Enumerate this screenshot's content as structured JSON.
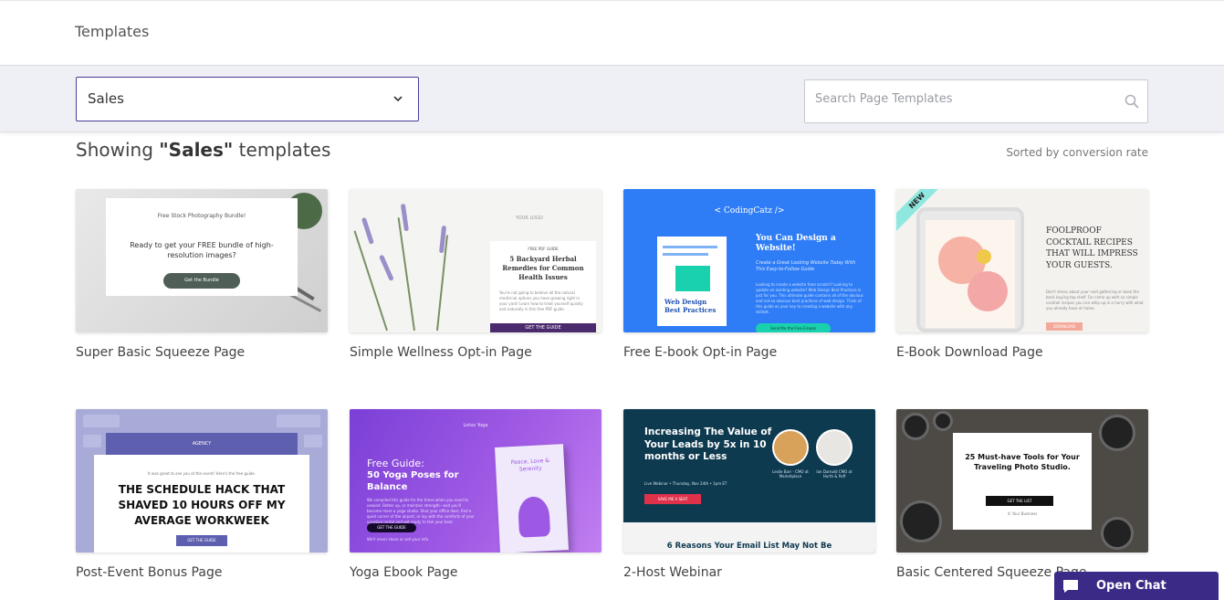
{
  "header": {
    "title": "Templates"
  },
  "filter": {
    "category_value": "Sales",
    "search_placeholder": "Search Page Templates"
  },
  "results": {
    "showing_prefix": "Showing ",
    "category": "\"Sales\"",
    "showing_suffix": " templates",
    "sorted_label": "Sorted by conversion rate"
  },
  "templates": [
    {
      "label": "Super Basic Squeeze Page",
      "thumb": {
        "line1": "Free Stock Photography Bundle!",
        "headline": "Ready to get your FREE bundle of high-resolution images?",
        "button": "Get the Bundle"
      }
    },
    {
      "label": "Simple Wellness Opt-in Page",
      "thumb": {
        "logo": "YOUR LOGO",
        "kicker": "FREE PDF GUIDE",
        "headline": "5 Backyard Herbal Remedies for Common Health Issues",
        "body": "You're not going to believe all the natural medicinal options you have growing right in your yard! Learn how to treat yourself quickly and naturally in this free PDF guide.",
        "button": "GET THE GUIDE"
      }
    },
    {
      "label": "Free E-book Opt-in Page",
      "thumb": {
        "brand": "< CodingCatz />",
        "book_title": "Web Design Best Practices",
        "headline": "You Can Design a Website!",
        "subhead": "Create a Great Looking Website Today With This Easy-to-Follow Guide",
        "body": "Looking to create a website from scratch? Looking to update an existing website? Web Design Best Practices is just for you. This ultimate guide contains all of the obvious and not-so-obvious best practices of web design. Think of this guide as your key to creating a website with any skillset.",
        "button": "Send Me the Free E-book"
      }
    },
    {
      "label": "E-Book Download Page",
      "thumb": {
        "badge": "NEW",
        "headline": "FOOLPROOF COCKTAIL RECIPES THAT WILL IMPRESS YOUR GUESTS.",
        "body": "Don't stress about your next gathering or book the bank buying top-shelf. For come up with so simple cocktail recipes you can whip up in a hurry with what you already have at home.",
        "button": "DOWNLOAD"
      }
    },
    {
      "label": "Post-Event Bonus Page",
      "thumb": {
        "header": "AGENCY",
        "line1": "It was great to see you at the event! Here's the free guide.",
        "headline": "THE SCHEDULE HACK THAT SHAVED 10 HOURS OFF MY AVERAGE WORKWEEK",
        "button": "GET THE GUIDE"
      }
    },
    {
      "label": "Yoga Ebook Page",
      "thumb": {
        "logo": "Lotus Yoga",
        "line1": "Free Guide:",
        "headline": "50 Yoga Poses for Balance",
        "body": "We compiled this guide for the times when you need to unwind. Better up, or maintain strength—and you'll become more a yoga studio. Shut your office door, find a quiet corner of the airport, or lay with the comforts of your vacation rental and get ready to feel your best.",
        "button": "GET THE GUIDE",
        "note": "We'll never share or sell your info.",
        "book": "Peace, Love & Serenity"
      }
    },
    {
      "label": "2-Host Webinar",
      "thumb": {
        "headline": "Increasing The Value of Your Leads by 5x in 10 months or Less",
        "date": "Live Webinar • Thursday, Nov 24th • 1pm ET",
        "button": "SAVE ME A SEAT",
        "host1": "Leslie Barr - CMO at Marketplace",
        "host2": "Ian Darnold CMO at Hurth & Puff",
        "bottom": "6 Reasons Your Email List May Not Be"
      }
    },
    {
      "label": "Basic Centered Squeeze Page",
      "thumb": {
        "headline": "25 Must-have Tools for Your Traveling Photo Studio.",
        "button": "GET THE LIST",
        "business": "© Your Business"
      }
    }
  ],
  "chat": {
    "label": "Open Chat"
  },
  "colors": {
    "accent": "#4b3b93",
    "chat_bg": "#3b2b86",
    "filter_bg": "#eef0f5"
  }
}
